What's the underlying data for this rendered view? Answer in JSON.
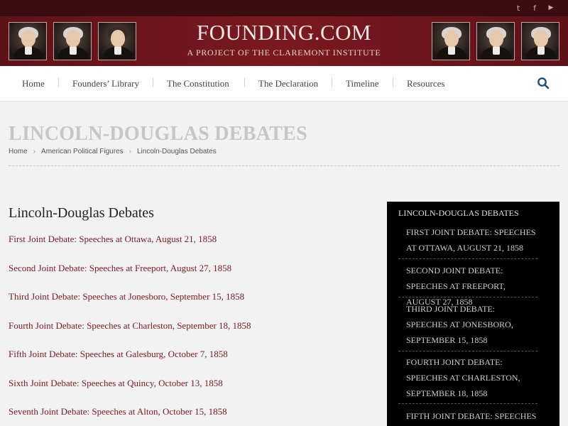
{
  "social": {
    "twitter": "t",
    "facebook": "f",
    "youtube": "▶"
  },
  "brand": {
    "title": "FOUNDING.COM",
    "subtitle": "A PROJECT OF THE CLAREMONT INSTITUTE"
  },
  "nav": {
    "items": [
      "Home",
      "Founders’ Library",
      "The Constitution",
      "The Declaration",
      "Timeline",
      "Resources"
    ]
  },
  "page": {
    "title": "LINCOLN-DOUGLAS DEBATES",
    "breadcrumb": [
      "Home",
      "American Political Figures",
      "Lincoln-Douglas Debates"
    ],
    "breadcrumb_sep": "›"
  },
  "main": {
    "heading": "Lincoln-Douglas Debates",
    "links": [
      "First Joint Debate: Speeches at Ottawa, August 21, 1858",
      "Second Joint Debate: Speeches at Freeport, August 27, 1858",
      "Third Joint Debate: Speeches at Jonesboro, September 15, 1858",
      "Fourth Joint Debate: Speeches at Charleston, September 18, 1858",
      "Fifth Joint Debate: Speeches at Galesburg, October 7, 1858",
      "Sixth Joint Debate: Speeches at Quincy, October 13, 1858",
      "Seventh Joint Debate: Speeches at Alton, October 15, 1858"
    ]
  },
  "sidebar": {
    "title": "LINCOLN-DOUGLAS DEBATES",
    "items": [
      "FIRST JOINT DEBATE: SPEECHES AT OTTAWA, AUGUST 21, 1858",
      "SECOND JOINT DEBATE: SPEECHES AT FREEPORT, AUGUST 27, 1858",
      "THIRD JOINT DEBATE: SPEECHES AT JONESBORO, SEPTEMBER 15, 1858",
      "FOURTH JOINT DEBATE: SPEECHES AT CHARLESTON, SEPTEMBER 18, 1858",
      "FIFTH JOINT DEBATE: SPEECHES"
    ]
  },
  "colors": {
    "brand": "#7a1a20",
    "topbar": "#3b0c10",
    "link": "#7a1a24",
    "sidebar": "#000000"
  }
}
